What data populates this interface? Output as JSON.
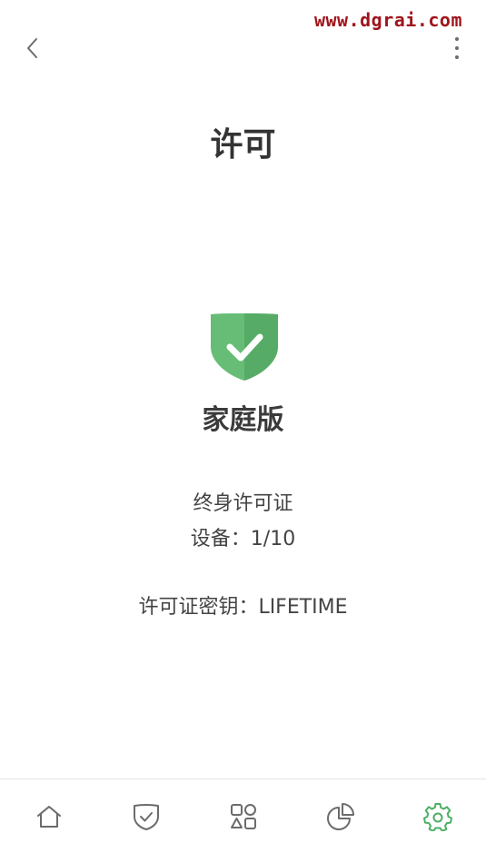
{
  "watermark": "www.dgrai.com",
  "header": {
    "title": "许可"
  },
  "license": {
    "edition": "家庭版",
    "type": "终身许可证",
    "devices_label": "设备：1/10",
    "key_label": "许可证密钥：LIFETIME"
  },
  "icons": {
    "shield": "shield-check-icon",
    "back": "chevron-left-icon",
    "more": "more-vertical-icon"
  },
  "bottom_nav": {
    "items": [
      {
        "icon": "home-icon",
        "active": false
      },
      {
        "icon": "shield-check-icon",
        "active": false
      },
      {
        "icon": "apps-icon",
        "active": false
      },
      {
        "icon": "pie-chart-icon",
        "active": false
      },
      {
        "icon": "gear-icon",
        "active": true
      }
    ]
  },
  "colors": {
    "accent": "#4caf64",
    "shield_light": "#67bd76",
    "shield_dark": "#56ac66",
    "icon_inactive": "#6b6b6b",
    "watermark": "#a0141b"
  }
}
